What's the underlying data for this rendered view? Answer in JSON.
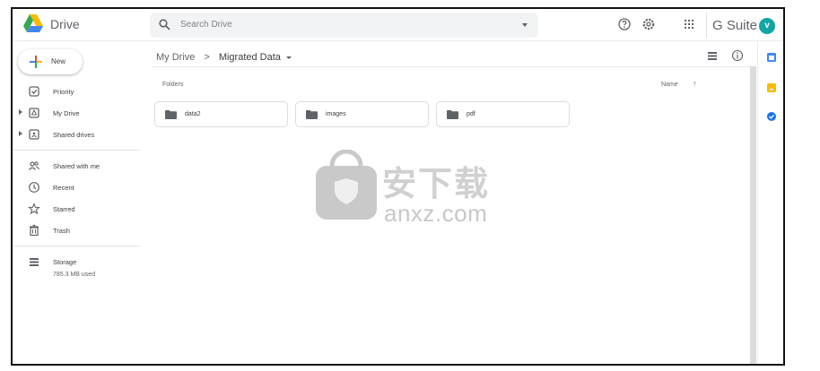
{
  "header": {
    "brand": "Drive",
    "search_placeholder": "Search Drive",
    "suite_label": "G Suite",
    "avatar_initial": "v"
  },
  "sidebar": {
    "new_label": "New",
    "items": [
      {
        "label": "Priority",
        "icon": "checkbox-icon"
      },
      {
        "label": "My Drive",
        "icon": "my-drive-icon"
      },
      {
        "label": "Shared drives",
        "icon": "shared-drives-icon"
      },
      {
        "label": "Shared with me",
        "icon": "people-icon"
      },
      {
        "label": "Recent",
        "icon": "clock-icon"
      },
      {
        "label": "Starred",
        "icon": "star-icon"
      },
      {
        "label": "Trash",
        "icon": "trash-icon"
      }
    ],
    "storage_label": "Storage",
    "storage_used": "785.3 MB used"
  },
  "main": {
    "breadcrumb_root": "My Drive",
    "breadcrumb_separator": ">",
    "breadcrumb_current": "Migrated Data",
    "folders_heading": "Folders",
    "sort_label": "Name",
    "folders": [
      {
        "name": "data2"
      },
      {
        "name": "images"
      },
      {
        "name": "pdf"
      }
    ]
  },
  "watermark": {
    "text": "anxz.com",
    "cn_text": "安下载"
  },
  "colors": {
    "accent_blue": "#4285f4",
    "avatar": "#12a4a4",
    "keep_yellow": "#fbbc04",
    "calendar_blue": "#4285f4",
    "tasks_blue": "#1a73e8"
  }
}
